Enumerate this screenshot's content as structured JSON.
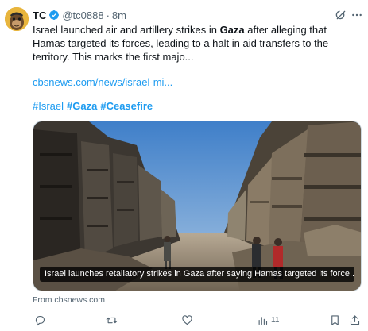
{
  "author": {
    "display_name": "TC",
    "handle": "@tc0888",
    "separator": "·",
    "time": "8m",
    "verified_color": "#1d9bf0"
  },
  "tweet": {
    "text_before": "Israel launched air and artillery strikes in ",
    "text_bold": "Gaza",
    "text_after": " after alleging that Hamas targeted its forces, leading to a halt in aid transfers to the territory. This marks the first majo...",
    "link": "cbsnews.com/news/israel-mi...",
    "hashtags": [
      "#Israel",
      "#Gaza",
      "#Ceasefire"
    ]
  },
  "card": {
    "caption": "Israel launches retaliatory strikes in Gaza after saying Hamas targeted its force...",
    "source": "From cbsnews.com"
  },
  "actions": {
    "reply_icon": "reply-icon",
    "retweet_icon": "retweet-icon",
    "like_icon": "heart-icon",
    "views_icon": "views-icon",
    "views_count": "11",
    "bookmark_icon": "bookmark-icon",
    "share_icon": "share-icon"
  },
  "colors": {
    "accent": "#1d9bf0",
    "secondary_text": "#536471",
    "primary_text": "#0f1419"
  }
}
